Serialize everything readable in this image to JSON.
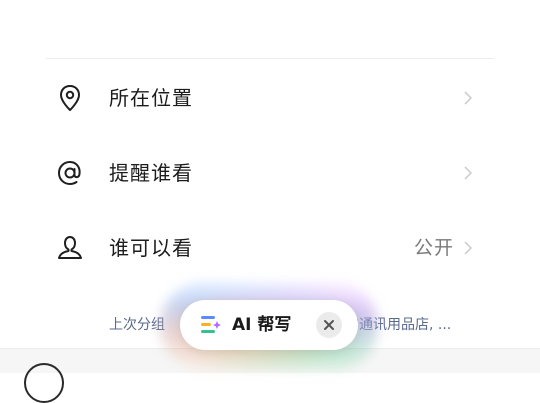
{
  "rows": [
    {
      "label": "所在位置",
      "icon": "location-pin-icon",
      "value": ""
    },
    {
      "label": "提醒谁看",
      "icon": "at-sign-icon",
      "value": ""
    },
    {
      "label": "谁可以看",
      "icon": "person-icon",
      "value": "公开"
    }
  ],
  "recent": {
    "prefix": "上次分组",
    "suffix": "雲通讯用品店, ..."
  },
  "ai_helper": {
    "label": "AI 帮写",
    "icon": "ai-write-icon",
    "close_icon": "close-icon"
  },
  "colors": {
    "text": "#1c1c1c",
    "secondary": "#7a7a7a",
    "link": "#5a6b8c",
    "chevron": "#c4c4c4"
  }
}
